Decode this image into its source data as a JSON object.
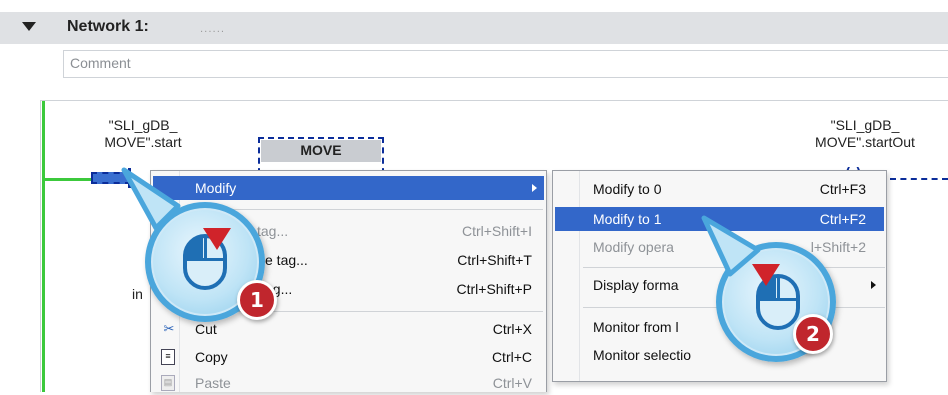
{
  "network": {
    "title": "Network 1:",
    "dots": "......"
  },
  "comment": {
    "label": "Comment"
  },
  "ladder": {
    "left_tag_line1": "\"SLI_gDB_",
    "left_tag_line2": "MOVE\".start",
    "right_tag_line1": "\"SLI_gDB_",
    "right_tag_line2": "MOVE\".startOut",
    "block_label": "MOVE",
    "coil_mark": "( )",
    "partial_text": "in"
  },
  "context_menu": {
    "items": [
      {
        "label": "Modify",
        "shortcut": "",
        "state": "highlighted",
        "has_submenu": true
      },
      {
        "label": "tag...",
        "shortcut": "Ctrl+Shift+I",
        "state": "disabled"
      },
      {
        "label": "e tag...",
        "shortcut": "Ctrl+Shift+T",
        "state": "normal"
      },
      {
        "label": "ag...",
        "shortcut": "Ctrl+Shift+P",
        "state": "normal"
      },
      {
        "label": "Cut",
        "shortcut": "Ctrl+X",
        "state": "normal",
        "icon": "scissors-icon"
      },
      {
        "label": "Copy",
        "shortcut": "Ctrl+C",
        "state": "normal",
        "icon": "copy-icon"
      },
      {
        "label": "Paste",
        "shortcut": "Ctrl+V",
        "state": "disabled",
        "icon": "paste-icon"
      }
    ]
  },
  "submenu": {
    "items": [
      {
        "label": "Modify to 0",
        "shortcut": "Ctrl+F3",
        "state": "normal"
      },
      {
        "label": "Modify to 1",
        "shortcut": "Ctrl+F2",
        "state": "highlighted"
      },
      {
        "label": "Modify opera",
        "shortcut": "l+Shift+2",
        "state": "disabled"
      },
      {
        "label": "Display forma",
        "shortcut": "",
        "state": "normal",
        "has_submenu": true
      },
      {
        "label": "Monitor from l",
        "shortcut": "",
        "state": "normal"
      },
      {
        "label": "Monitor selectio",
        "shortcut": "",
        "state": "normal"
      }
    ]
  },
  "callouts": [
    {
      "number": "1",
      "icon": "mouse-icon"
    },
    {
      "number": "2",
      "icon": "mouse-icon"
    }
  ],
  "colors": {
    "highlight": "#3367c9",
    "power_rail": "#3cc93c",
    "selection_dashed": "#0b2d9a",
    "badge": "#c0262d"
  }
}
